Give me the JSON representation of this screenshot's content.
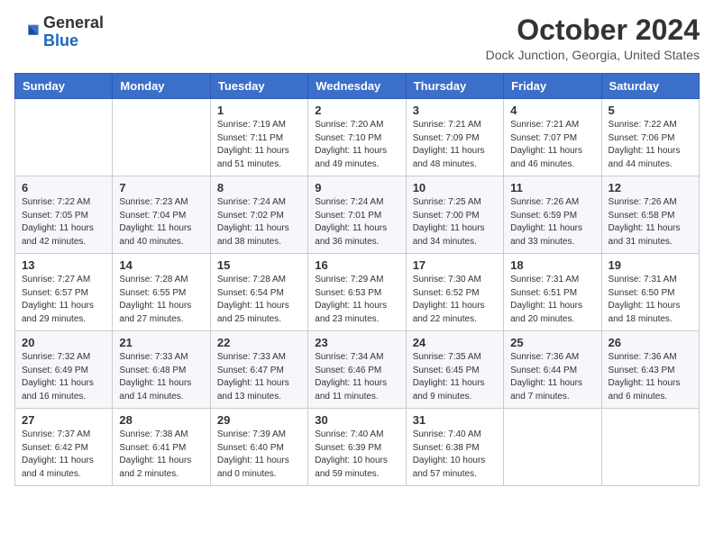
{
  "logo": {
    "general": "General",
    "blue": "Blue"
  },
  "header": {
    "title": "October 2024",
    "location": "Dock Junction, Georgia, United States"
  },
  "weekdays": [
    "Sunday",
    "Monday",
    "Tuesday",
    "Wednesday",
    "Thursday",
    "Friday",
    "Saturday"
  ],
  "weeks": [
    [
      null,
      null,
      {
        "day": 1,
        "sunrise": "7:19 AM",
        "sunset": "7:11 PM",
        "daylight": "11 hours and 51 minutes."
      },
      {
        "day": 2,
        "sunrise": "7:20 AM",
        "sunset": "7:10 PM",
        "daylight": "11 hours and 49 minutes."
      },
      {
        "day": 3,
        "sunrise": "7:21 AM",
        "sunset": "7:09 PM",
        "daylight": "11 hours and 48 minutes."
      },
      {
        "day": 4,
        "sunrise": "7:21 AM",
        "sunset": "7:07 PM",
        "daylight": "11 hours and 46 minutes."
      },
      {
        "day": 5,
        "sunrise": "7:22 AM",
        "sunset": "7:06 PM",
        "daylight": "11 hours and 44 minutes."
      }
    ],
    [
      {
        "day": 6,
        "sunrise": "7:22 AM",
        "sunset": "7:05 PM",
        "daylight": "11 hours and 42 minutes."
      },
      {
        "day": 7,
        "sunrise": "7:23 AM",
        "sunset": "7:04 PM",
        "daylight": "11 hours and 40 minutes."
      },
      {
        "day": 8,
        "sunrise": "7:24 AM",
        "sunset": "7:02 PM",
        "daylight": "11 hours and 38 minutes."
      },
      {
        "day": 9,
        "sunrise": "7:24 AM",
        "sunset": "7:01 PM",
        "daylight": "11 hours and 36 minutes."
      },
      {
        "day": 10,
        "sunrise": "7:25 AM",
        "sunset": "7:00 PM",
        "daylight": "11 hours and 34 minutes."
      },
      {
        "day": 11,
        "sunrise": "7:26 AM",
        "sunset": "6:59 PM",
        "daylight": "11 hours and 33 minutes."
      },
      {
        "day": 12,
        "sunrise": "7:26 AM",
        "sunset": "6:58 PM",
        "daylight": "11 hours and 31 minutes."
      }
    ],
    [
      {
        "day": 13,
        "sunrise": "7:27 AM",
        "sunset": "6:57 PM",
        "daylight": "11 hours and 29 minutes."
      },
      {
        "day": 14,
        "sunrise": "7:28 AM",
        "sunset": "6:55 PM",
        "daylight": "11 hours and 27 minutes."
      },
      {
        "day": 15,
        "sunrise": "7:28 AM",
        "sunset": "6:54 PM",
        "daylight": "11 hours and 25 minutes."
      },
      {
        "day": 16,
        "sunrise": "7:29 AM",
        "sunset": "6:53 PM",
        "daylight": "11 hours and 23 minutes."
      },
      {
        "day": 17,
        "sunrise": "7:30 AM",
        "sunset": "6:52 PM",
        "daylight": "11 hours and 22 minutes."
      },
      {
        "day": 18,
        "sunrise": "7:31 AM",
        "sunset": "6:51 PM",
        "daylight": "11 hours and 20 minutes."
      },
      {
        "day": 19,
        "sunrise": "7:31 AM",
        "sunset": "6:50 PM",
        "daylight": "11 hours and 18 minutes."
      }
    ],
    [
      {
        "day": 20,
        "sunrise": "7:32 AM",
        "sunset": "6:49 PM",
        "daylight": "11 hours and 16 minutes."
      },
      {
        "day": 21,
        "sunrise": "7:33 AM",
        "sunset": "6:48 PM",
        "daylight": "11 hours and 14 minutes."
      },
      {
        "day": 22,
        "sunrise": "7:33 AM",
        "sunset": "6:47 PM",
        "daylight": "11 hours and 13 minutes."
      },
      {
        "day": 23,
        "sunrise": "7:34 AM",
        "sunset": "6:46 PM",
        "daylight": "11 hours and 11 minutes."
      },
      {
        "day": 24,
        "sunrise": "7:35 AM",
        "sunset": "6:45 PM",
        "daylight": "11 hours and 9 minutes."
      },
      {
        "day": 25,
        "sunrise": "7:36 AM",
        "sunset": "6:44 PM",
        "daylight": "11 hours and 7 minutes."
      },
      {
        "day": 26,
        "sunrise": "7:36 AM",
        "sunset": "6:43 PM",
        "daylight": "11 hours and 6 minutes."
      }
    ],
    [
      {
        "day": 27,
        "sunrise": "7:37 AM",
        "sunset": "6:42 PM",
        "daylight": "11 hours and 4 minutes."
      },
      {
        "day": 28,
        "sunrise": "7:38 AM",
        "sunset": "6:41 PM",
        "daylight": "11 hours and 2 minutes."
      },
      {
        "day": 29,
        "sunrise": "7:39 AM",
        "sunset": "6:40 PM",
        "daylight": "11 hours and 0 minutes."
      },
      {
        "day": 30,
        "sunrise": "7:40 AM",
        "sunset": "6:39 PM",
        "daylight": "10 hours and 59 minutes."
      },
      {
        "day": 31,
        "sunrise": "7:40 AM",
        "sunset": "6:38 PM",
        "daylight": "10 hours and 57 minutes."
      },
      null,
      null
    ]
  ],
  "labels": {
    "sunrise": "Sunrise:",
    "sunset": "Sunset:",
    "daylight": "Daylight:"
  }
}
